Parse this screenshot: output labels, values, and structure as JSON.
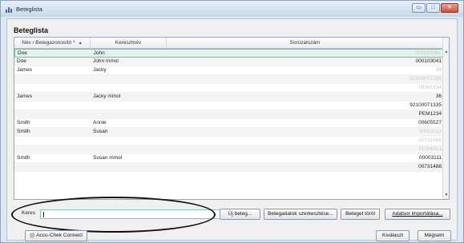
{
  "window": {
    "title": "Beteglista",
    "min_symbol": "▭",
    "max_symbol": "□",
    "close_symbol": "✕"
  },
  "heading": "Beteglista",
  "table": {
    "columns": [
      "Név / Betegazonosító *",
      "Keresztnév",
      "Sorozatszám"
    ],
    "sort_indicator": "▲",
    "rows": [
      {
        "last": "Doe",
        "first": "John",
        "serial": "000103041",
        "selected": true,
        "faded": true
      },
      {
        "last": "Doe",
        "first": "John mmol",
        "serial": "000103041",
        "selected": false,
        "faded": false
      },
      {
        "last": "James",
        "first": "Jacky",
        "serial": "36",
        "selected": false,
        "faded": true
      },
      {
        "last": "",
        "first": "",
        "serial": "92100071335",
        "selected": false,
        "faded": true
      },
      {
        "last": "",
        "first": "",
        "serial": "PEM1234",
        "selected": false,
        "faded": true
      },
      {
        "last": "James",
        "first": "Jacky mmol",
        "serial": "36",
        "selected": false,
        "faded": false
      },
      {
        "last": "",
        "first": "",
        "serial": "92100071335",
        "selected": false,
        "faded": false
      },
      {
        "last": "",
        "first": "",
        "serial": "PEM1234",
        "selected": false,
        "faded": false
      },
      {
        "last": "Smith",
        "first": "Annie",
        "serial": "00605527",
        "selected": false,
        "faded": false
      },
      {
        "last": "Smith",
        "first": "Susan",
        "serial": "00003111",
        "selected": false,
        "faded": true
      },
      {
        "last": "",
        "first": "",
        "serial": "00731488",
        "selected": false,
        "faded": true
      },
      {
        "last": "",
        "first": "",
        "serial": "31004313",
        "selected": false,
        "faded": true
      },
      {
        "last": "Smith",
        "first": "Susan mmol",
        "serial": "00003111",
        "selected": false,
        "faded": false
      },
      {
        "last": "",
        "first": "",
        "serial": "00731488",
        "selected": false,
        "faded": false
      }
    ]
  },
  "search": {
    "label": "Keres",
    "value": ""
  },
  "buttons": {
    "new_patient": "Új beteg...",
    "edit_patient": "Betegadatok szerkesztése...",
    "delete_patient": "Beteget töröl",
    "import": "Adatsor importálása...",
    "connect": "Accu-Chek Connect",
    "choose": "Kiválaszt",
    "cancel": "Mégsem"
  },
  "colors": {
    "selected_row": "#dff3ef",
    "faded_text": "#c7c7c7",
    "accent": "#82c2b4"
  }
}
